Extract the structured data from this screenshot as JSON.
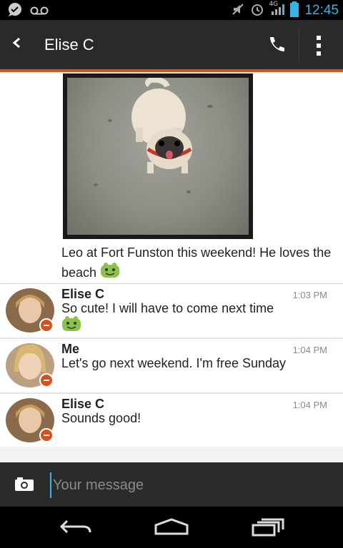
{
  "status_bar": {
    "time": "12:45",
    "network": "4G"
  },
  "action_bar": {
    "title": "Elise C"
  },
  "photo_message": {
    "caption": "Leo at Fort Funston this weekend! He loves the beach"
  },
  "messages": [
    {
      "sender": "Elise C",
      "time": "1:03 PM",
      "text": "So cute! I will have to come next time"
    },
    {
      "sender": "Me",
      "time": "1:04 PM",
      "text": "Let's go next weekend. I'm free Sunday"
    },
    {
      "sender": "Elise C",
      "time": "1:04 PM",
      "text": "Sounds good!"
    }
  ],
  "composer": {
    "placeholder": "Your message"
  },
  "colors": {
    "accent": "#d9501e",
    "status_blue": "#33b5e5",
    "action_bar": "#2a2a2a"
  }
}
